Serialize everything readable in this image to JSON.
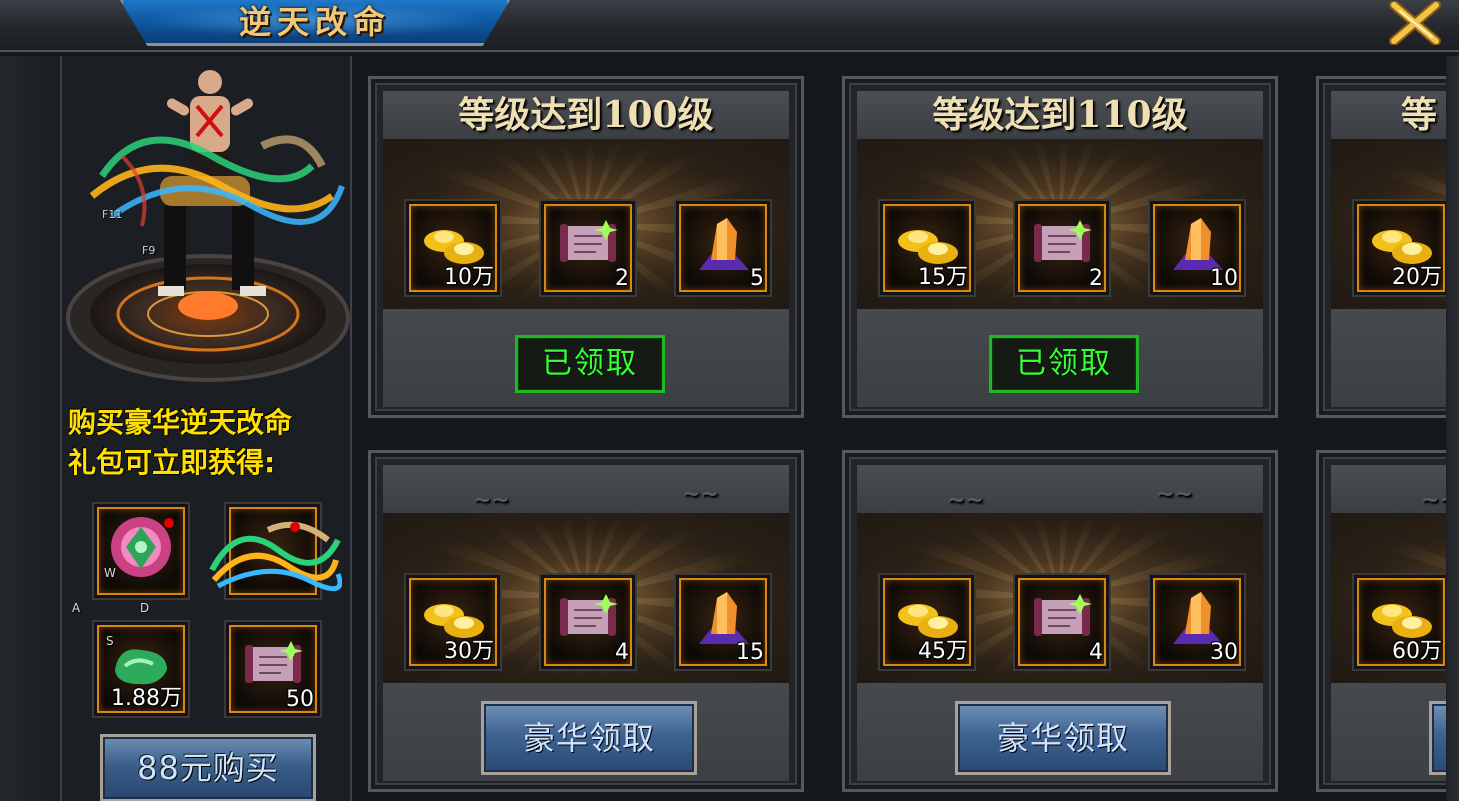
{
  "window": {
    "title": "逆天改命"
  },
  "left": {
    "hero_tags": [
      "F11",
      "F9"
    ],
    "promo_lines": [
      "购买豪华逆天改命",
      "礼包可立即获得:"
    ],
    "items": [
      {
        "icon": "pink-gem-icon",
        "count": "",
        "letter": "W",
        "badge": true
      },
      {
        "icon": "wings-effect-icon",
        "count": "",
        "letter": "",
        "badge": true
      },
      {
        "icon": "jade-stone-icon",
        "count": "1.88万",
        "letter": "S",
        "badge": false
      },
      {
        "icon": "scroll-icon",
        "count": "50",
        "letter": "",
        "badge": false
      }
    ],
    "slot_letters": [
      "A",
      "D"
    ],
    "buy_label": "88元购买"
  },
  "cards": [
    {
      "title": "等级达到100级",
      "rewards": [
        {
          "icon": "gold-ingot-icon",
          "count": "10万"
        },
        {
          "icon": "scroll-icon",
          "count": "2"
        },
        {
          "icon": "crystal-icon",
          "count": "5"
        }
      ],
      "action": "已领取"
    },
    {
      "title": "等级达到110级",
      "rewards": [
        {
          "icon": "gold-ingot-icon",
          "count": "15万"
        },
        {
          "icon": "scroll-icon",
          "count": "2"
        },
        {
          "icon": "crystal-icon",
          "count": "10"
        }
      ],
      "action": "已领取"
    },
    {
      "title": "等",
      "rewards": [
        {
          "icon": "gold-ingot-icon",
          "count": "20万"
        }
      ],
      "action": ""
    },
    {
      "title": "",
      "rewards": [
        {
          "icon": "gold-ingot-icon",
          "count": "30万"
        },
        {
          "icon": "scroll-icon",
          "count": "4"
        },
        {
          "icon": "crystal-icon",
          "count": "15"
        }
      ],
      "action": "豪华领取"
    },
    {
      "title": "",
      "rewards": [
        {
          "icon": "gold-ingot-icon",
          "count": "45万"
        },
        {
          "icon": "scroll-icon",
          "count": "4"
        },
        {
          "icon": "crystal-icon",
          "count": "30"
        }
      ],
      "action": "豪华领取"
    },
    {
      "title": "",
      "rewards": [
        {
          "icon": "gold-ingot-icon",
          "count": "60万"
        }
      ],
      "action": ""
    }
  ]
}
